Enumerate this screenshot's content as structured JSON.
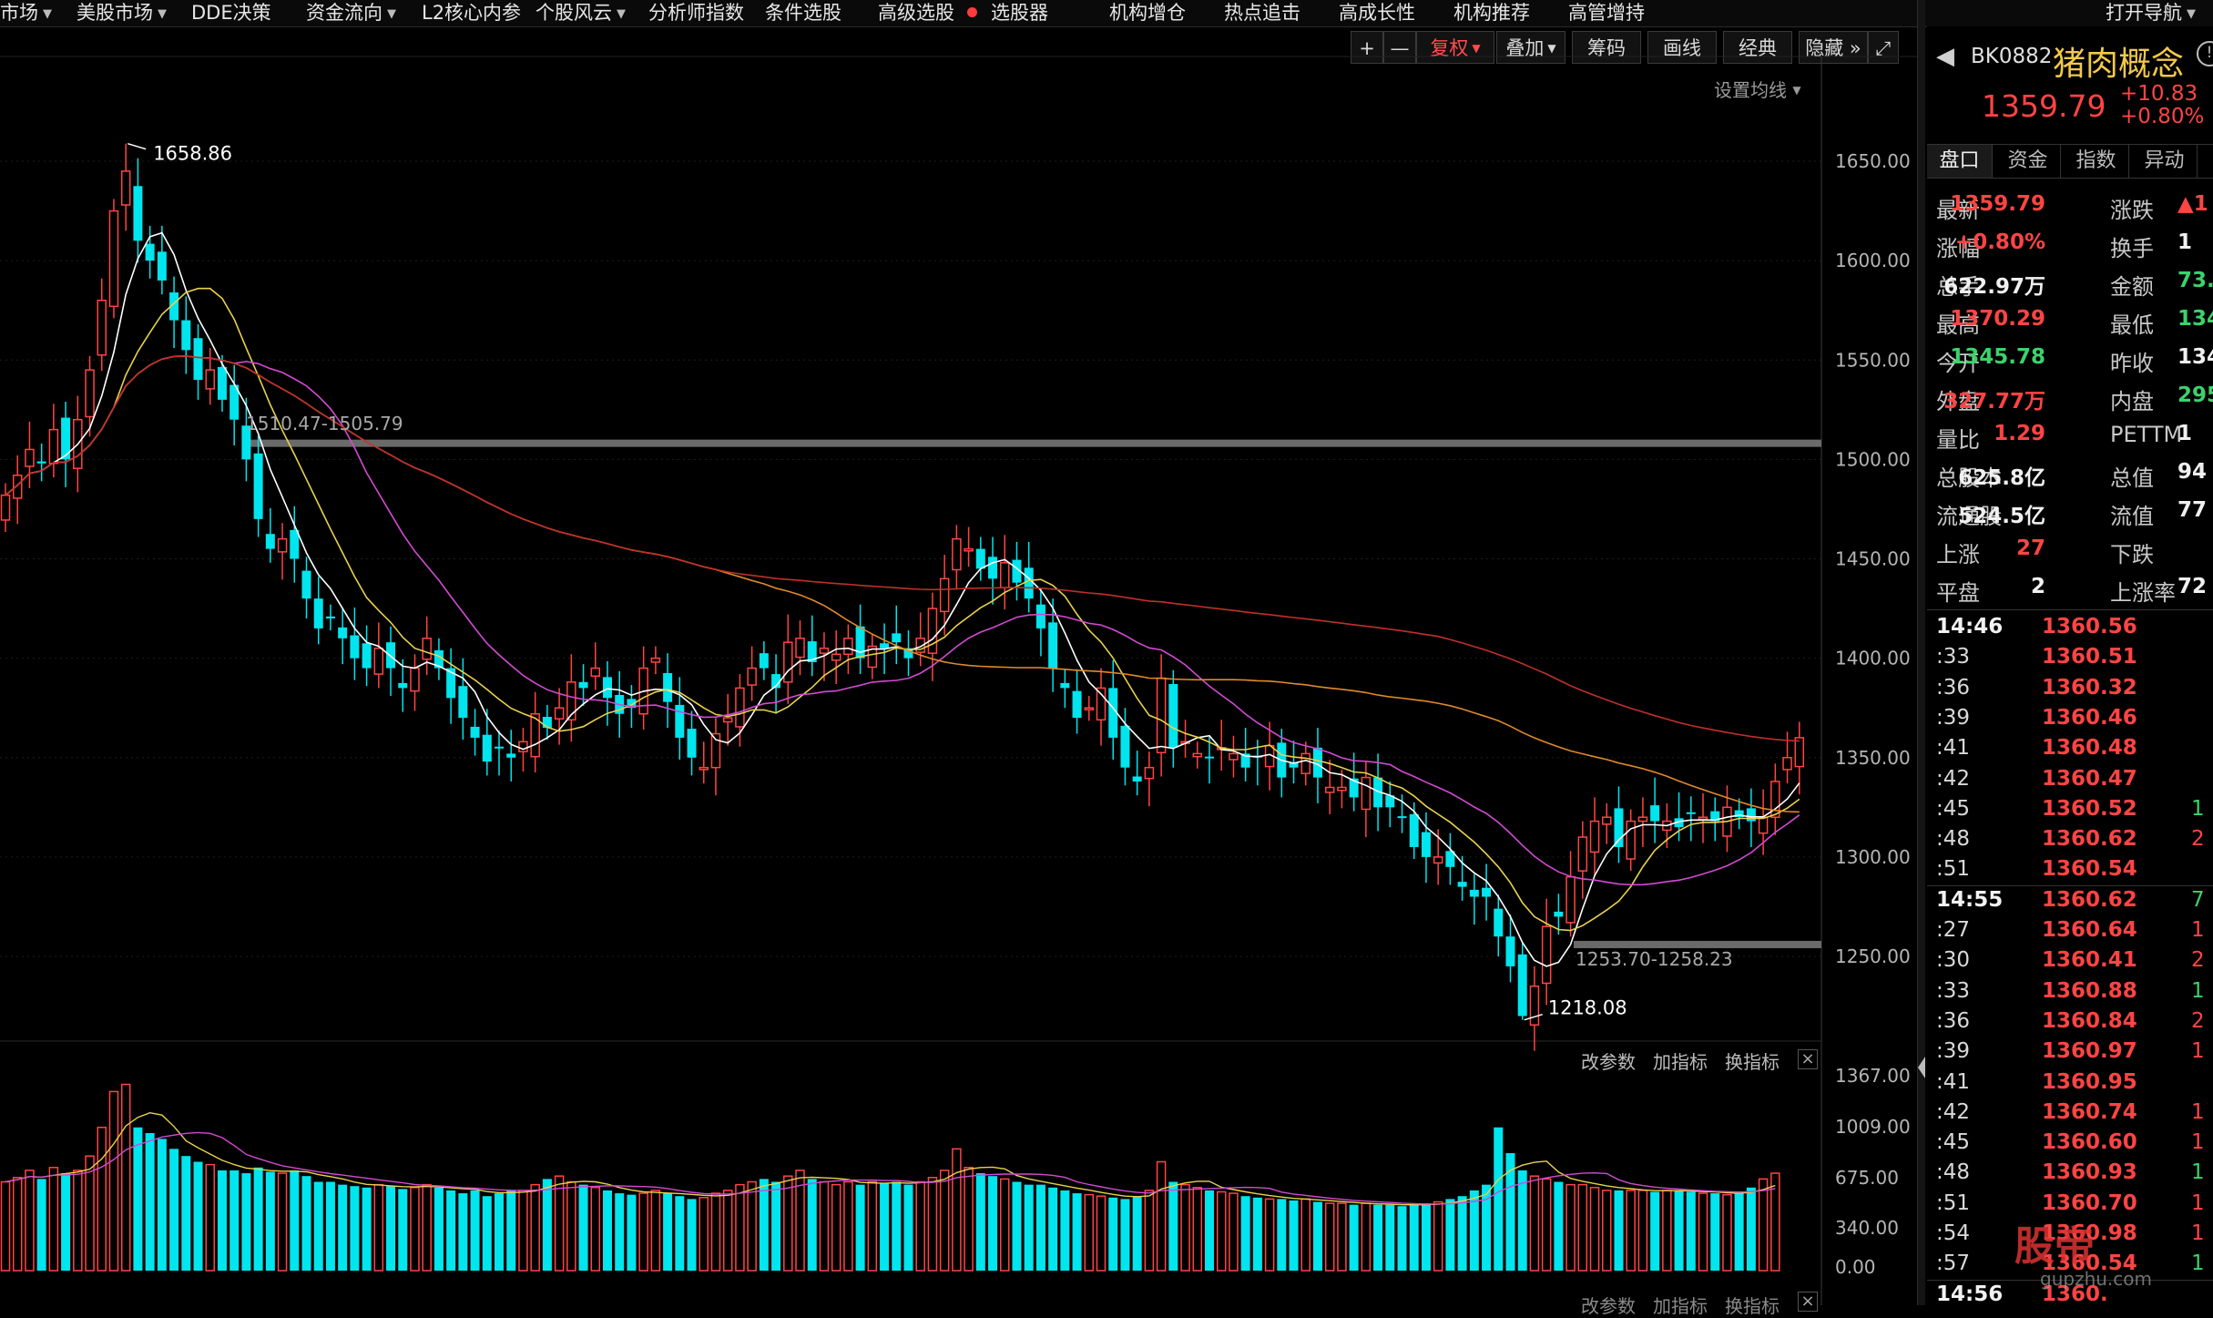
{
  "menu": {
    "items": [
      {
        "label": "市场",
        "caret": true
      },
      {
        "label": "美股市场",
        "caret": true
      },
      {
        "label": "DDE决策",
        "caret": false
      },
      {
        "label": "资金流向",
        "caret": true
      },
      {
        "label": "L2核心内参",
        "caret": false
      },
      {
        "label": "个股风云",
        "caret": true
      },
      {
        "label": "分析师指数",
        "caret": false
      },
      {
        "label": "条件选股",
        "caret": false
      },
      {
        "label": "高级选股",
        "caret": false
      },
      {
        "label": "选股器",
        "caret": false
      },
      {
        "label": "机构增仓",
        "caret": false
      },
      {
        "label": "热点追击",
        "caret": false
      },
      {
        "label": "高成长性",
        "caret": false
      },
      {
        "label": "机构推荐",
        "caret": false
      },
      {
        "label": "高管增持",
        "caret": false
      }
    ],
    "right_label": "打开导航"
  },
  "toolbar": {
    "plus": "+",
    "minus": "—",
    "fuquan": "复权",
    "diejia": "叠加",
    "chouma": "筹码",
    "huaxian": "画线",
    "jingdian": "经典",
    "yincang": "隐藏",
    "more": "»",
    "expand": "⤢"
  },
  "ma_settings": "设置均线",
  "price_axis": [
    "1650.00",
    "1600.00",
    "1550.00",
    "1500.00",
    "1450.00",
    "1400.00",
    "1350.00",
    "1300.00",
    "1250.00"
  ],
  "annotations": {
    "high": "1658.86",
    "low": "1218.08",
    "zone_upper": "1510.47-1505.79",
    "zone_lower": "1253.70-1258.23"
  },
  "volume_panel": {
    "tools": [
      "改参数",
      "加指标",
      "换指标"
    ],
    "close": "×",
    "axis": [
      "1367.00",
      "1009.00",
      "675.00",
      "340.00",
      "0.00"
    ]
  },
  "chart_data": {
    "type": "candlestick",
    "ylim": [
      1200,
      1680
    ],
    "high_mark": 1658.86,
    "low_mark": 1218.08,
    "zones": [
      {
        "label": "1510.47-1505.79",
        "low": 1505.79,
        "high": 1510.47
      },
      {
        "label": "1253.70-1258.23",
        "low": 1253.7,
        "high": 1258.23
      }
    ],
    "closes": [
      1482,
      1492,
      1505,
      1498,
      1515,
      1500,
      1520,
      1545,
      1580,
      1625,
      1645,
      1610,
      1600,
      1590,
      1570,
      1555,
      1540,
      1545,
      1530,
      1520,
      1500,
      1470,
      1455,
      1460,
      1450,
      1430,
      1415,
      1420,
      1410,
      1400,
      1395,
      1405,
      1395,
      1385,
      1395,
      1410,
      1395,
      1380,
      1370,
      1360,
      1348,
      1355,
      1350,
      1358,
      1372,
      1365,
      1375,
      1388,
      1385,
      1395,
      1380,
      1372,
      1375,
      1395,
      1400,
      1378,
      1360,
      1350,
      1345,
      1362,
      1370,
      1385,
      1395,
      1395,
      1385,
      1408,
      1410,
      1398,
      1405,
      1402,
      1410,
      1400,
      1406,
      1405,
      1408,
      1400,
      1410,
      1425,
      1440,
      1460,
      1455,
      1445,
      1440,
      1448,
      1438,
      1430,
      1415,
      1395,
      1385,
      1370,
      1375,
      1385,
      1360,
      1345,
      1338,
      1345,
      1390,
      1355,
      1358,
      1352,
      1350,
      1355,
      1352,
      1345,
      1350,
      1356,
      1340,
      1345,
      1352,
      1340,
      1335,
      1335,
      1330,
      1340,
      1325,
      1325,
      1320,
      1305,
      1300,
      1300,
      1295,
      1285,
      1280,
      1280,
      1260,
      1245,
      1220,
      1235,
      1265,
      1270,
      1290,
      1310,
      1318,
      1320,
      1305,
      1318,
      1320,
      1318,
      1318,
      1315,
      1322,
      1320,
      1318,
      1325,
      1320,
      1318,
      1320,
      1338,
      1350,
      1360
    ],
    "volumes": [
      620,
      650,
      700,
      640,
      720,
      680,
      700,
      800,
      1000,
      1250,
      1300,
      1000,
      960,
      920,
      850,
      800,
      760,
      740,
      700,
      700,
      680,
      720,
      690,
      680,
      700,
      660,
      620,
      620,
      600,
      590,
      580,
      600,
      590,
      570,
      580,
      600,
      580,
      560,
      540,
      560,
      520,
      540,
      560,
      560,
      600,
      640,
      660,
      620,
      600,
      580,
      560,
      540,
      530,
      540,
      560,
      540,
      520,
      500,
      510,
      540,
      560,
      600,
      620,
      640,
      620,
      660,
      700,
      640,
      620,
      600,
      620,
      600,
      620,
      610,
      620,
      600,
      620,
      650,
      700,
      850,
      720,
      680,
      660,
      640,
      620,
      600,
      600,
      580,
      560,
      540,
      530,
      520,
      510,
      500,
      520,
      560,
      760,
      620,
      600,
      580,
      560,
      550,
      540,
      520,
      510,
      500,
      500,
      490,
      500,
      480,
      470,
      470,
      460,
      470,
      460,
      460,
      450,
      460,
      470,
      480,
      500,
      520,
      560,
      600,
      1000,
      820,
      700,
      660,
      640,
      620,
      600,
      600,
      580,
      560,
      560,
      560,
      560,
      550,
      560,
      560,
      550,
      540,
      540,
      530,
      540,
      580,
      640,
      680
    ]
  },
  "right_panel": {
    "code": "BK0882",
    "name": "猪肉概念",
    "price": "1359.79",
    "change": "+10.83",
    "change_pct": "+0.80%",
    "tabs": [
      "盘口",
      "资金",
      "指数",
      "异动"
    ],
    "quote_rows": [
      {
        "l1": "最新",
        "v1": "1359.79",
        "c1": "red",
        "l2": "涨跌",
        "v2": "▲1",
        "c2": "red"
      },
      {
        "l1": "涨幅",
        "v1": "+0.80%",
        "c1": "red",
        "l2": "换手",
        "v2": "1",
        "c2": "white"
      },
      {
        "l1": "总手",
        "v1": "622.97万",
        "c1": "white",
        "l2": "金额",
        "v2": "73.",
        "c2": "green"
      },
      {
        "l1": "最高",
        "v1": "1370.29",
        "c1": "red",
        "l2": "最低",
        "v2": "134",
        "c2": "green"
      },
      {
        "l1": "今开",
        "v1": "1345.78",
        "c1": "green",
        "l2": "昨收",
        "v2": "134",
        "c2": "white"
      },
      {
        "l1": "外盘",
        "v1": "327.77万",
        "c1": "red",
        "l2": "内盘",
        "v2": "295.",
        "c2": "green"
      },
      {
        "l1": "量比",
        "v1": "1.29",
        "c1": "red",
        "l2": "PETTM",
        "v2": "1",
        "c2": "white"
      },
      {
        "l1": "总股本",
        "v1": "625.8亿",
        "c1": "white",
        "l2": "总值",
        "v2": "94",
        "c2": "white"
      },
      {
        "l1": "流通股",
        "v1": "524.5亿",
        "c1": "white",
        "l2": "流值",
        "v2": "77",
        "c2": "white"
      },
      {
        "l1": "上涨",
        "v1": "27",
        "c1": "red",
        "l2": "下跌",
        "v2": "",
        "c2": "white"
      },
      {
        "l1": "平盘",
        "v1": "2",
        "c1": "white",
        "l2": "上涨率",
        "v2": "72",
        "c2": "white"
      }
    ],
    "ticks": [
      {
        "time": "14:46",
        "big": true,
        "price": "1360.56",
        "vol": ""
      },
      {
        "time": ":33",
        "big": false,
        "price": "1360.51",
        "vol": ""
      },
      {
        "time": ":36",
        "big": false,
        "price": "1360.32",
        "vol": ""
      },
      {
        "time": ":39",
        "big": false,
        "price": "1360.46",
        "vol": ""
      },
      {
        "time": ":41",
        "big": false,
        "price": "1360.48",
        "vol": ""
      },
      {
        "time": ":42",
        "big": false,
        "price": "1360.47",
        "vol": ""
      },
      {
        "time": ":45",
        "big": false,
        "price": "1360.52",
        "vol": "1"
      },
      {
        "time": ":48",
        "big": false,
        "price": "1360.62",
        "vol": "2"
      },
      {
        "time": ":51",
        "big": false,
        "price": "1360.54",
        "vol": ""
      },
      {
        "time": "14:55",
        "big": true,
        "price": "1360.62",
        "vol": "7"
      },
      {
        "time": ":27",
        "big": false,
        "price": "1360.64",
        "vol": "1"
      },
      {
        "time": ":30",
        "big": false,
        "price": "1360.41",
        "vol": "2"
      },
      {
        "time": ":33",
        "big": false,
        "price": "1360.88",
        "vol": "1"
      },
      {
        "time": ":36",
        "big": false,
        "price": "1360.84",
        "vol": "2"
      },
      {
        "time": ":39",
        "big": false,
        "price": "1360.97",
        "vol": "1"
      },
      {
        "time": ":41",
        "big": false,
        "price": "1360.95",
        "vol": ""
      },
      {
        "time": ":42",
        "big": false,
        "price": "1360.74",
        "vol": "1"
      },
      {
        "time": ":45",
        "big": false,
        "price": "1360.60",
        "vol": "1"
      },
      {
        "time": ":48",
        "big": false,
        "price": "1360.93",
        "vol": "1"
      },
      {
        "time": ":51",
        "big": false,
        "price": "1360.70",
        "vol": "1"
      },
      {
        "time": ":54",
        "big": false,
        "price": "1360.98",
        "vol": "1"
      },
      {
        "time": ":57",
        "big": false,
        "price": "1360.54",
        "vol": "1"
      },
      {
        "time": "14:56",
        "big": true,
        "price": "1360.",
        "vol": ""
      }
    ]
  },
  "watermark": "股帝 ",
  "watermark_url": "gupzhu.com",
  "colors": {
    "up": "#ff4444",
    "down": "#00e5ee",
    "ma5": "#ffffff",
    "ma10": "#e8d24a",
    "ma20": "#d24ad2",
    "ma60": "#e0892a",
    "ma120": "#c0302a"
  }
}
